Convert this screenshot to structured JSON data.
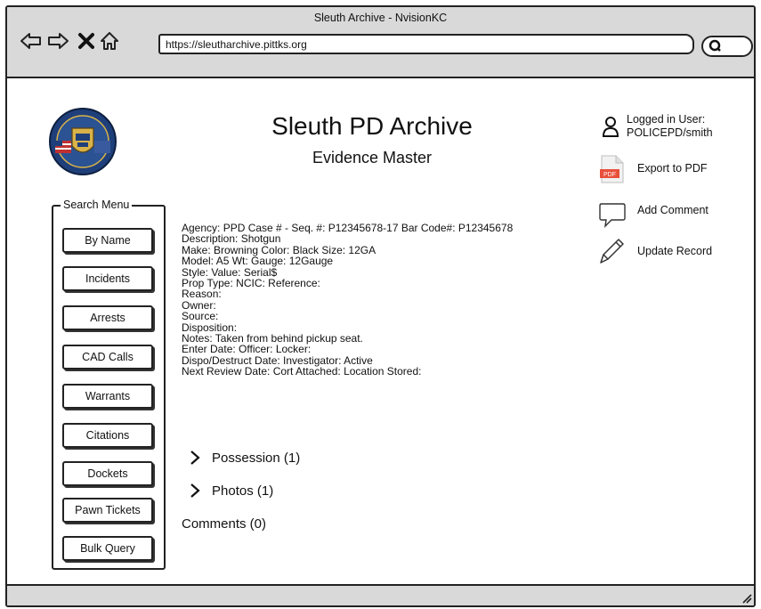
{
  "window": {
    "title": "Sleuth Archive - NvisionKC",
    "url": "https://sleutharchive.pittks.org"
  },
  "header": {
    "title": "Sleuth PD Archive",
    "subtitle": "Evidence Master"
  },
  "user": {
    "label": "Logged in User:",
    "name": "POLICEPD/smith"
  },
  "actions": {
    "export_label": "Export to PDF",
    "pdf_badge": "PDF",
    "comment_label": "Add Comment",
    "update_label": "Update Record"
  },
  "search_menu": {
    "legend": "Search Menu",
    "items": [
      "By Name",
      "Incidents",
      "Arrests",
      "CAD Calls",
      "Warrants",
      "Citations",
      "Dockets",
      "Pawn Tickets",
      "Bulk Query"
    ]
  },
  "record": {
    "lines": [
      "Agency: PPD Case # - Seq. #: P12345678-17   Bar Code#: P12345678",
      "Description: Shotgun",
      "Make: Browning  Color: Black  Size: 12GA",
      "Model: A5   Wt:  Gauge:  12Gauge",
      "Style:   Value:     Serial$",
      "Prop Type:   NCIC:   Reference:",
      "Reason:",
      "Owner:",
      "Source:",
      "Disposition:",
      "Notes: Taken from behind pickup seat.",
      "Enter Date:    Officer:      Locker:",
      "Dispo/Destruct Date:   Investigator:    Active",
      "Next Review Date:    Cort Attached:   Location Stored:"
    ]
  },
  "sections": {
    "possession": "Possession (1)",
    "photos": "Photos (1)",
    "comments": "Comments (0)"
  },
  "colors": {
    "chrome": "#d9d9d9",
    "pdf_red": "#e8503a",
    "badge_blue": "#1f3f7a",
    "badge_gold": "#d9b24a"
  }
}
